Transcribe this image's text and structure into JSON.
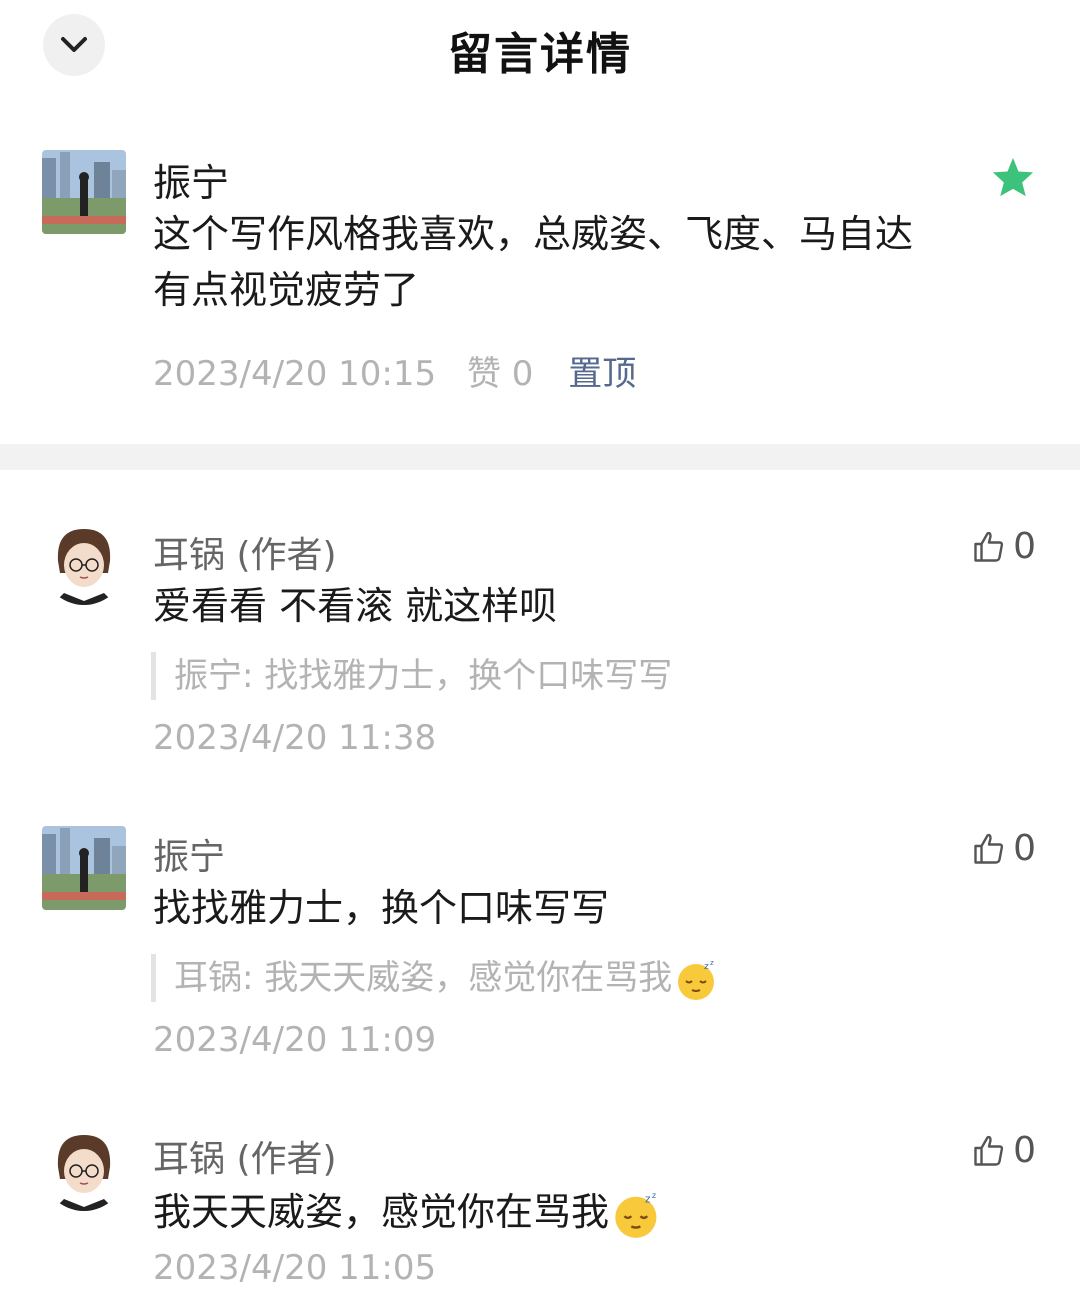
{
  "header": {
    "title": "留言详情"
  },
  "top_comment": {
    "author": "振宁",
    "content": "这个写作风格我喜欢，总威姿、飞度、马自达有点视觉疲劳了",
    "time": "2023/4/20 10:15",
    "likes": "赞 0",
    "pin_label": "置顶"
  },
  "replies": [
    {
      "author": "耳锅 (作者)",
      "content": "爱看看 不看滚 就这样呗",
      "quote": "振宁: 找找雅力士，换个口味写写",
      "time": "2023/4/20 11:38",
      "likes": "0"
    },
    {
      "author": "振宁",
      "content": "找找雅力士，换个口味写写",
      "quote": "耳锅: 我天天威姿，感觉你在骂我",
      "time": "2023/4/20 11:09",
      "likes": "0"
    },
    {
      "author": "耳锅 (作者)",
      "content": "我天天威姿，感觉你在骂我",
      "time": "2023/4/20 11:05",
      "likes": "0"
    }
  ],
  "colors": {
    "star": "#3cc27a",
    "pin_link": "#55698f"
  }
}
